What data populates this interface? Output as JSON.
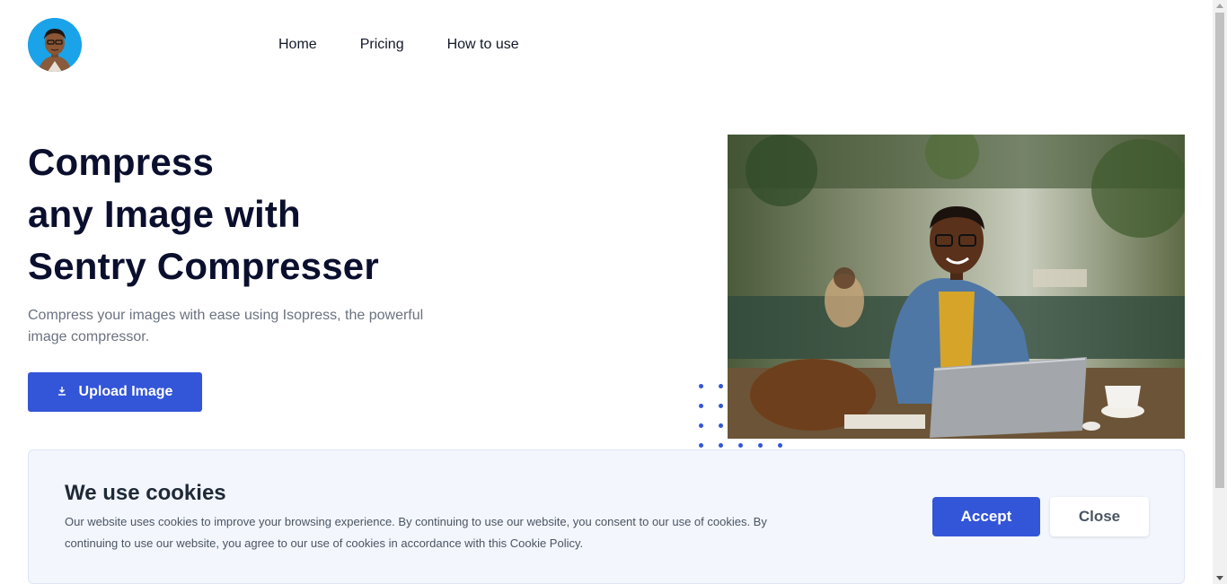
{
  "nav": {
    "items": [
      "Home",
      "Pricing",
      "How to use"
    ]
  },
  "hero": {
    "title_lines": [
      "Compress",
      "any Image with",
      "Sentry Compresser"
    ],
    "subtitle": "Compress your images with ease using Isopress, the powerful image compressor.",
    "upload_label": "Upload Image",
    "upload_icon": "download-icon"
  },
  "cookie": {
    "title": "We use cookies",
    "text": "Our website uses cookies to improve your browsing experience. By continuing to use our website, you consent to our use of cookies. By continuing to use our website, you agree to our use of cookies in accordance with this Cookie Policy.",
    "accept_label": "Accept",
    "close_label": "Close"
  },
  "colors": {
    "accent": "#3355d8",
    "logo_bg": "#1aa3e8",
    "cookie_bg": "#f3f6fd",
    "heading": "#0b0f2e"
  }
}
